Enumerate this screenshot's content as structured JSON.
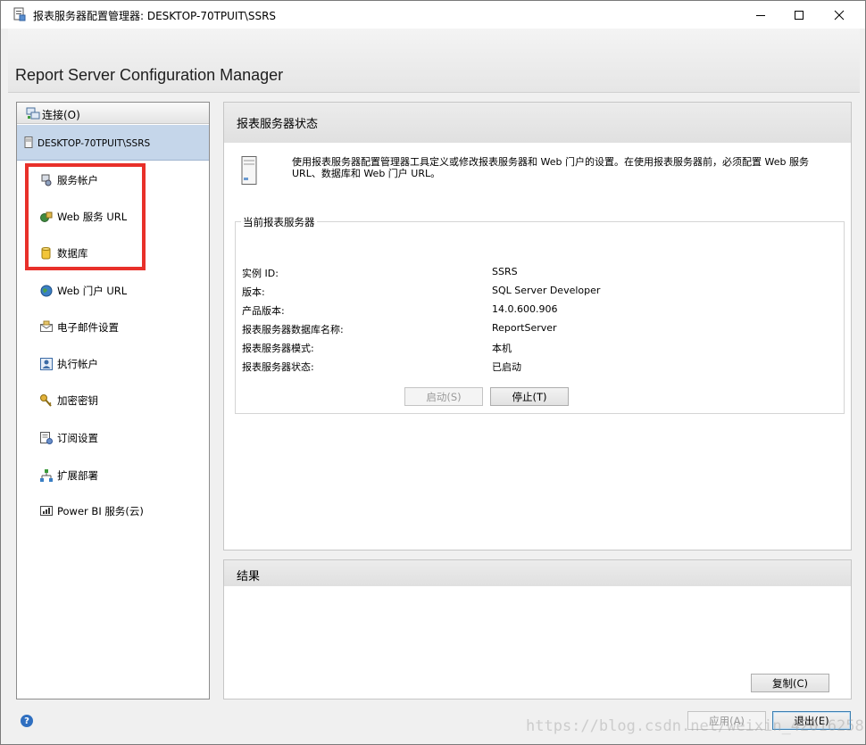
{
  "window": {
    "title": "报表服务器配置管理器: DESKTOP-70TPUIT\\SSRS",
    "app_title": "Report Server Configuration Manager"
  },
  "sidebar": {
    "connect_label": "连接(O)",
    "server_label": "DESKTOP-70TPUIT\\SSRS",
    "items": [
      {
        "label": "服务帐户",
        "icon": "service-account-icon"
      },
      {
        "label": "Web 服务 URL",
        "icon": "web-service-url-icon"
      },
      {
        "label": "数据库",
        "icon": "database-icon"
      },
      {
        "label": "Web 门户 URL",
        "icon": "globe-icon"
      },
      {
        "label": "电子邮件设置",
        "icon": "email-icon"
      },
      {
        "label": "执行帐户",
        "icon": "execution-account-icon"
      },
      {
        "label": "加密密钥",
        "icon": "key-icon"
      },
      {
        "label": "订阅设置",
        "icon": "subscription-icon"
      },
      {
        "label": "扩展部署",
        "icon": "scale-out-icon"
      },
      {
        "label": "Power BI 服务(云)",
        "icon": "power-bi-icon"
      }
    ]
  },
  "status_panel": {
    "heading": "报表服务器状态",
    "description": "使用报表服务器配置管理器工具定义或修改报表服务器和 Web 门户的设置。在使用报表服务器前，必须配置 Web 服务 URL、数据库和 Web 门户 URL。",
    "group_title": "当前报表服务器",
    "fields": [
      {
        "label": "实例 ID:",
        "value": "SSRS"
      },
      {
        "label": "版本:",
        "value": "SQL Server Developer"
      },
      {
        "label": "产品版本:",
        "value": "14.0.600.906"
      },
      {
        "label": "报表服务器数据库名称:",
        "value": "ReportServer"
      },
      {
        "label": "报表服务器模式:",
        "value": "本机"
      },
      {
        "label": "报表服务器状态:",
        "value": "已启动"
      }
    ],
    "start_button": "启动(S)",
    "stop_button": "停止(T)"
  },
  "result_panel": {
    "heading": "结果",
    "copy_button": "复制(C)"
  },
  "footer": {
    "apply_button": "应用(A)",
    "exit_button": "退出(E)",
    "watermark": "https://blog.csdn.net/weixin_42016258"
  },
  "colors": {
    "selected_bg": "#c5d6ea",
    "highlight_box": "#e8302a",
    "help": "#2f6fc0"
  }
}
